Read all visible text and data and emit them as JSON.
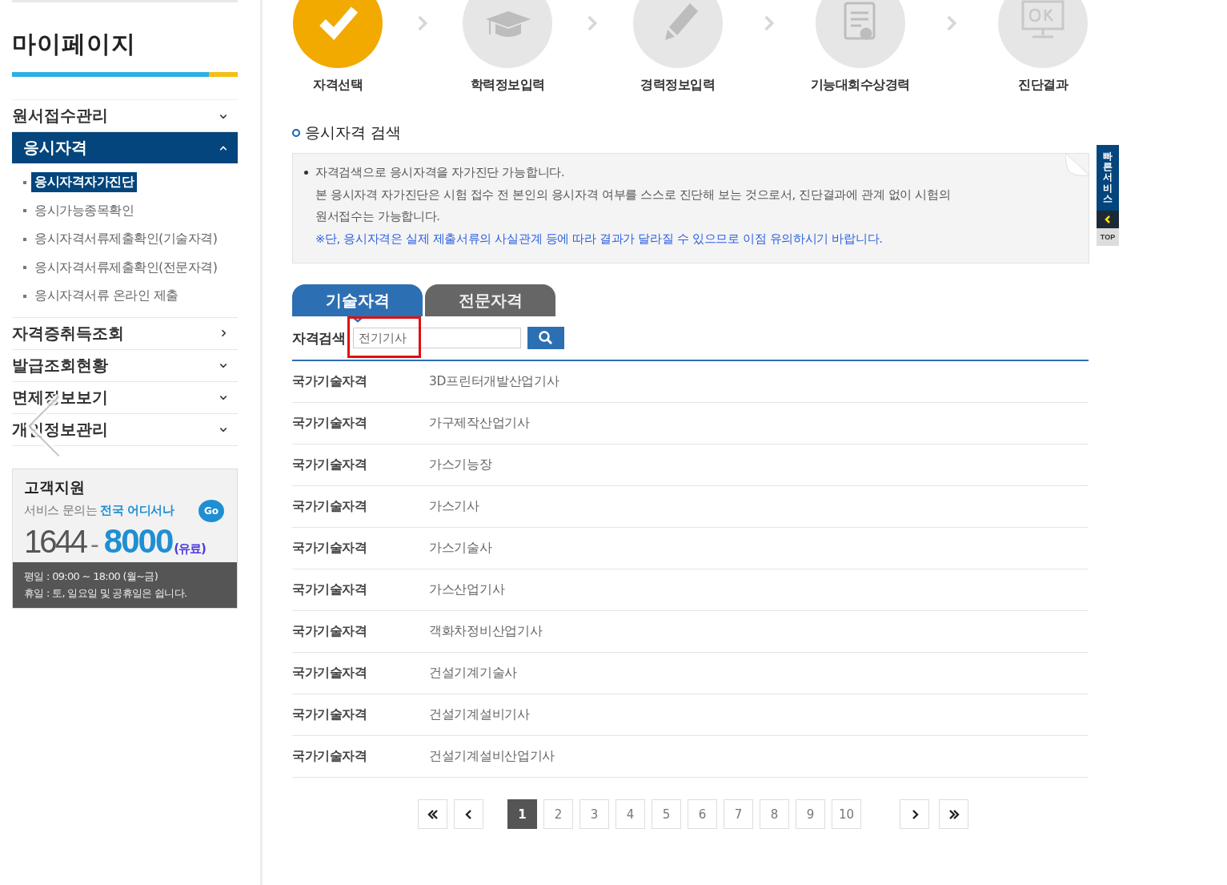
{
  "sidebar": {
    "title": "마이페이지",
    "menu": [
      {
        "label": "원서접수관리",
        "kind": "toggle",
        "expanded": false
      },
      {
        "label": "응시자격",
        "kind": "toggle",
        "expanded": true,
        "children": [
          {
            "label": "응시자격자가진단",
            "selected": true
          },
          {
            "label": "응시가능종목확인",
            "selected": false
          },
          {
            "label": "응시자격서류제출확인(기술자격)",
            "selected": false
          },
          {
            "label": "응시자격서류제출확인(전문자격)",
            "selected": false
          },
          {
            "label": "응시자격서류 온라인 제출",
            "selected": false
          }
        ]
      },
      {
        "label": "자격증취득조회",
        "kind": "link",
        "expanded": false
      },
      {
        "label": "발급조회현황",
        "kind": "toggle",
        "expanded": false
      },
      {
        "label": "면제정보보기",
        "kind": "toggle",
        "expanded": false
      },
      {
        "label": "개인정보관리",
        "kind": "toggle",
        "expanded": false
      }
    ],
    "support": {
      "title": "고객지원",
      "subtitle": "서비스 문의는",
      "subtitle_highlight": "전국 어디서나",
      "go": "Go",
      "phone_prefix": "1644",
      "dash": "-",
      "phone_main": "8000",
      "fee": "(유료)",
      "hours": [
        "평일 : 09:00 ~ 18:00 (월~금)",
        "휴일 : 토, 일요일 및 공휴일은 쉽니다."
      ]
    }
  },
  "steps": [
    {
      "label": "자격선택",
      "kind": "check",
      "done": true
    },
    {
      "label": "학력정보입력",
      "kind": "cap",
      "done": false
    },
    {
      "label": "경력정보입력",
      "kind": "pencil",
      "done": false
    },
    {
      "label": "기능대회수상경력",
      "kind": "certificate",
      "done": false
    },
    {
      "label": "진단결과",
      "kind": "monitor",
      "done": false
    }
  ],
  "section_title": "응시자격 검색",
  "notice": [
    {
      "kind": "bullet",
      "text": "자격검색으로 응시자격을 자가진단 가능합니다."
    },
    {
      "kind": "plain",
      "text": "본 응시자격 자가진단은 시험 접수 전 본인의 응시자격 여부를 스스로 진단해 보는 것으로서, 진단결과에 관계 없이 시험의"
    },
    {
      "kind": "plain",
      "text": "원서접수는 가능합니다."
    },
    {
      "kind": "warning",
      "text": "※단, 응시자격은 실제 제출서류의 사실관계 등에 따라 결과가 달라질 수 있으므로 이점 유의하시기 바랍니다."
    }
  ],
  "quick_service": {
    "label": "빠른서비스",
    "top": "TOP"
  },
  "tabs": [
    {
      "label": "기술자격",
      "selected": true
    },
    {
      "label": "전문자격",
      "selected": false
    }
  ],
  "search": {
    "label": "자격검색",
    "value": "전기기사",
    "highlighted": true
  },
  "results": [
    {
      "category": "국가기술자격",
      "name": "3D프린터개발산업기사"
    },
    {
      "category": "국가기술자격",
      "name": "가구제작산업기사"
    },
    {
      "category": "국가기술자격",
      "name": "가스기능장"
    },
    {
      "category": "국가기술자격",
      "name": "가스기사"
    },
    {
      "category": "국가기술자격",
      "name": "가스기술사"
    },
    {
      "category": "국가기술자격",
      "name": "가스산업기사"
    },
    {
      "category": "국가기술자격",
      "name": "객화차정비산업기사"
    },
    {
      "category": "국가기술자격",
      "name": "건설기계기술사"
    },
    {
      "category": "국가기술자격",
      "name": "건설기계설비기사"
    },
    {
      "category": "국가기술자격",
      "name": "건설기계설비산업기사"
    }
  ],
  "pagination": [
    {
      "label": "1",
      "selected": true
    },
    {
      "label": "2",
      "selected": false
    },
    {
      "label": "3",
      "selected": false
    },
    {
      "label": "4",
      "selected": false
    },
    {
      "label": "5",
      "selected": false
    },
    {
      "label": "6",
      "selected": false
    },
    {
      "label": "7",
      "selected": false
    },
    {
      "label": "8",
      "selected": false
    },
    {
      "label": "9",
      "selected": false
    },
    {
      "label": "10",
      "selected": false
    }
  ]
}
